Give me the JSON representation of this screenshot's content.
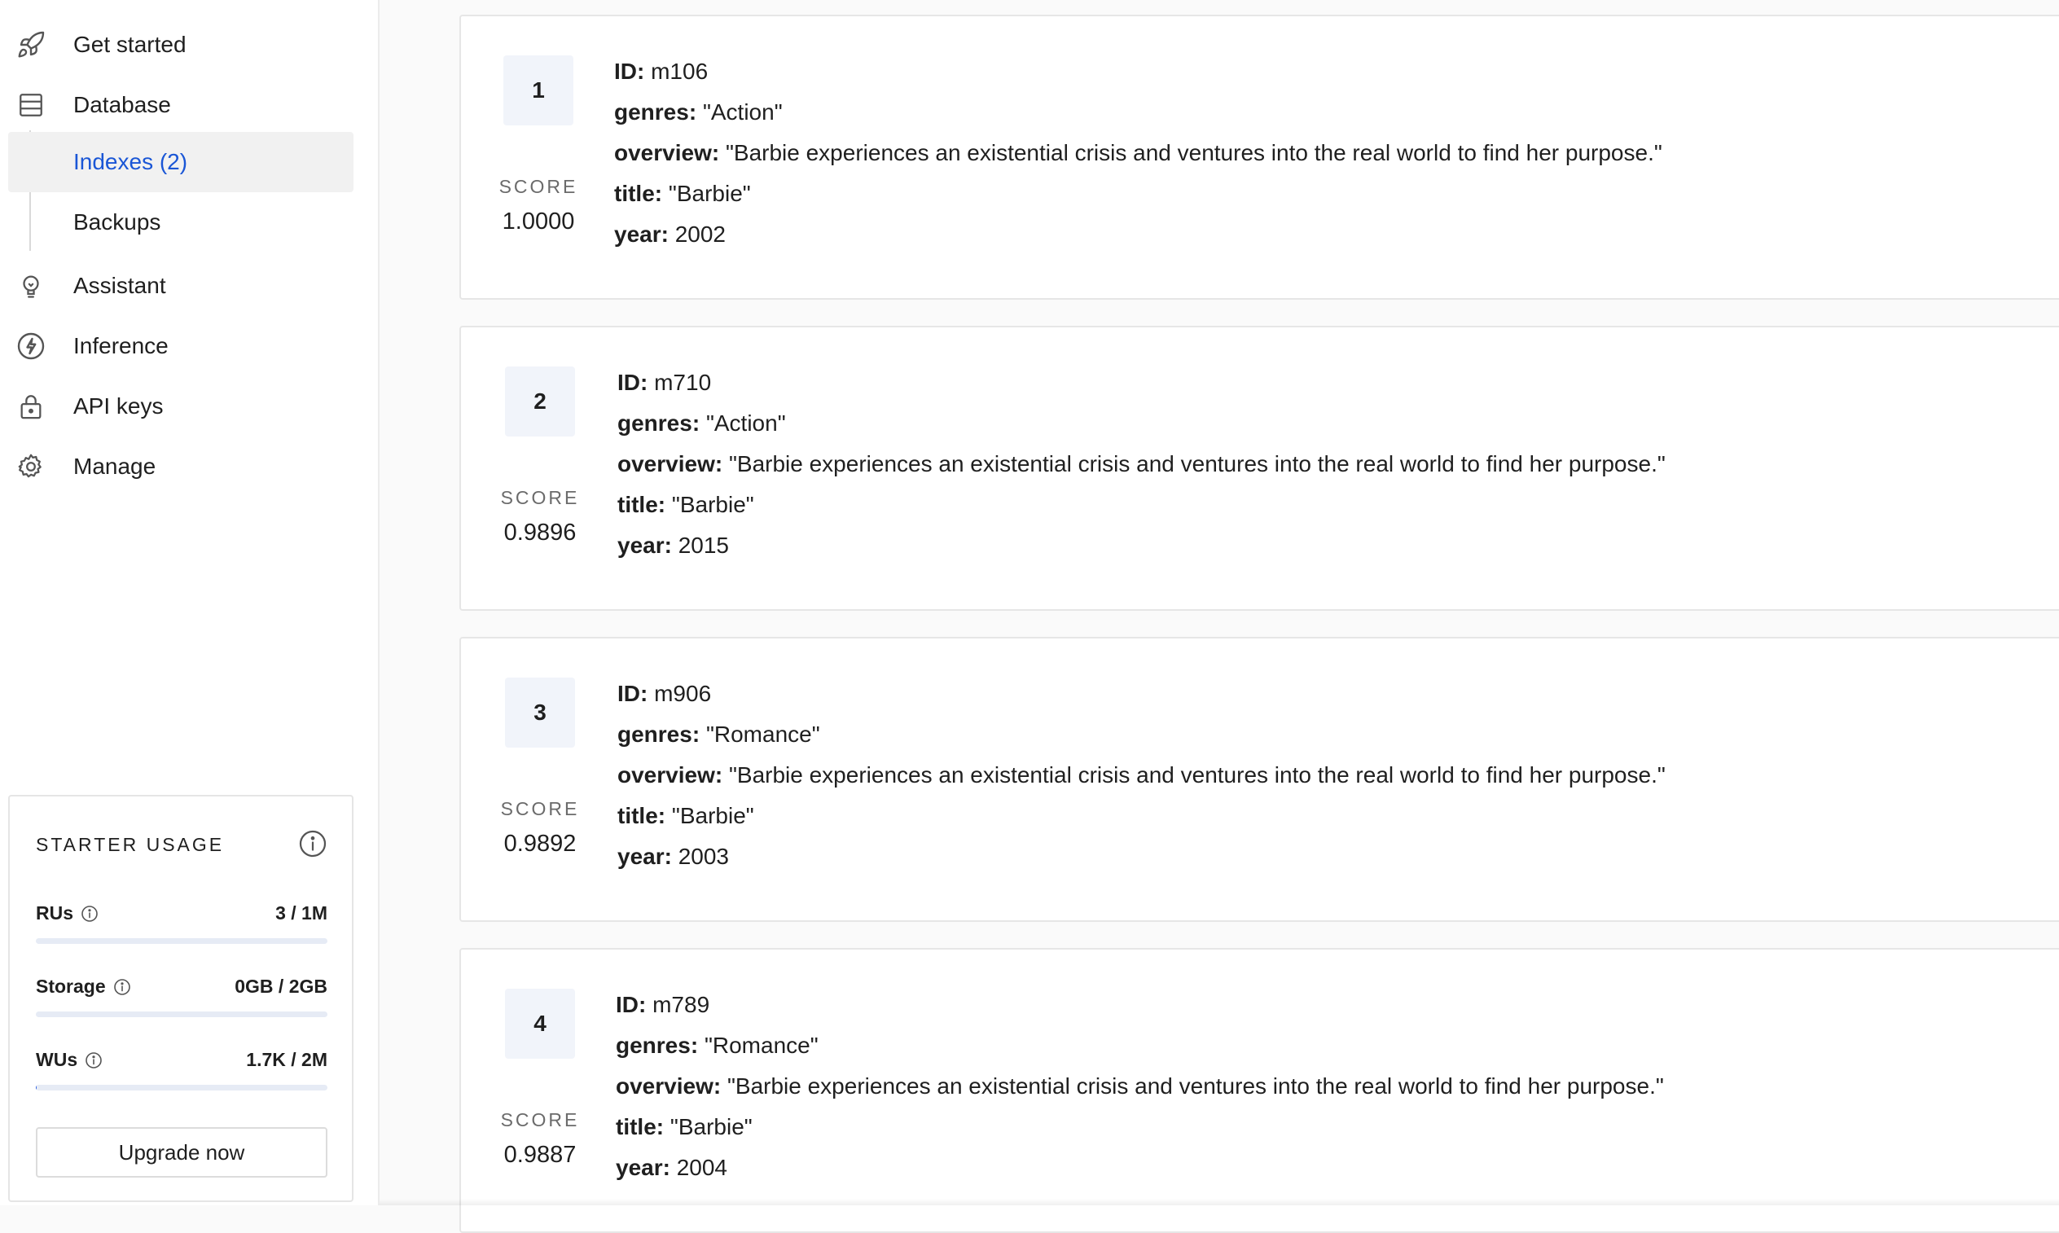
{
  "sidebar": {
    "nav": {
      "get_started": "Get started",
      "database": "Database",
      "assistant": "Assistant",
      "inference": "Inference",
      "api_keys": "API keys",
      "manage": "Manage"
    },
    "sub": {
      "indexes": "Indexes (2)",
      "backups": "Backups"
    },
    "icons": {
      "get_started": "rocket-icon",
      "database": "database-icon",
      "assistant": "lightbulb-icon",
      "inference": "bolt-icon",
      "api_keys": "lock-icon",
      "manage": "gear-icon"
    },
    "active_item": "indexes",
    "accent_color": "#1a56d6"
  },
  "usage": {
    "title": "STARTER USAGE",
    "rows": [
      {
        "label": "RUs",
        "value": "3 / 1M",
        "fill_fraction": 0.0
      },
      {
        "label": "Storage",
        "value": "0GB / 2GB",
        "fill_fraction": 0.0
      },
      {
        "label": "WUs",
        "value": "1.7K / 2M",
        "fill_fraction": 0.001
      }
    ],
    "upgrade_label": "Upgrade now"
  },
  "results": {
    "score_label": "SCORE",
    "field_labels": {
      "id": "ID:",
      "genres": "genres:",
      "overview": "overview:",
      "title": "title:",
      "year": "year:"
    },
    "items": [
      {
        "rank": "1",
        "score": "1.0000",
        "id": "m106",
        "genres": "\"Action\"",
        "overview": "\"Barbie experiences an existential crisis and ventures into the real world to find her purpose.\"",
        "title": "\"Barbie\"",
        "year": "2002"
      },
      {
        "rank": "2",
        "score": "0.9896",
        "id": "m710",
        "genres": "\"Action\"",
        "overview": "\"Barbie experiences an existential crisis and ventures into the real world to find her purpose.\"",
        "title": "\"Barbie\"",
        "year": "2015"
      },
      {
        "rank": "3",
        "score": "0.9892",
        "id": "m906",
        "genres": "\"Romance\"",
        "overview": "\"Barbie experiences an existential crisis and ventures into the real world to find her purpose.\"",
        "title": "\"Barbie\"",
        "year": "2003"
      },
      {
        "rank": "4",
        "score": "0.9887",
        "id": "m789",
        "genres": "\"Romance\"",
        "overview": "\"Barbie experiences an existential crisis and ventures into the real world to find her purpose.\"",
        "title": "\"Barbie\"",
        "year": "2004"
      }
    ]
  }
}
